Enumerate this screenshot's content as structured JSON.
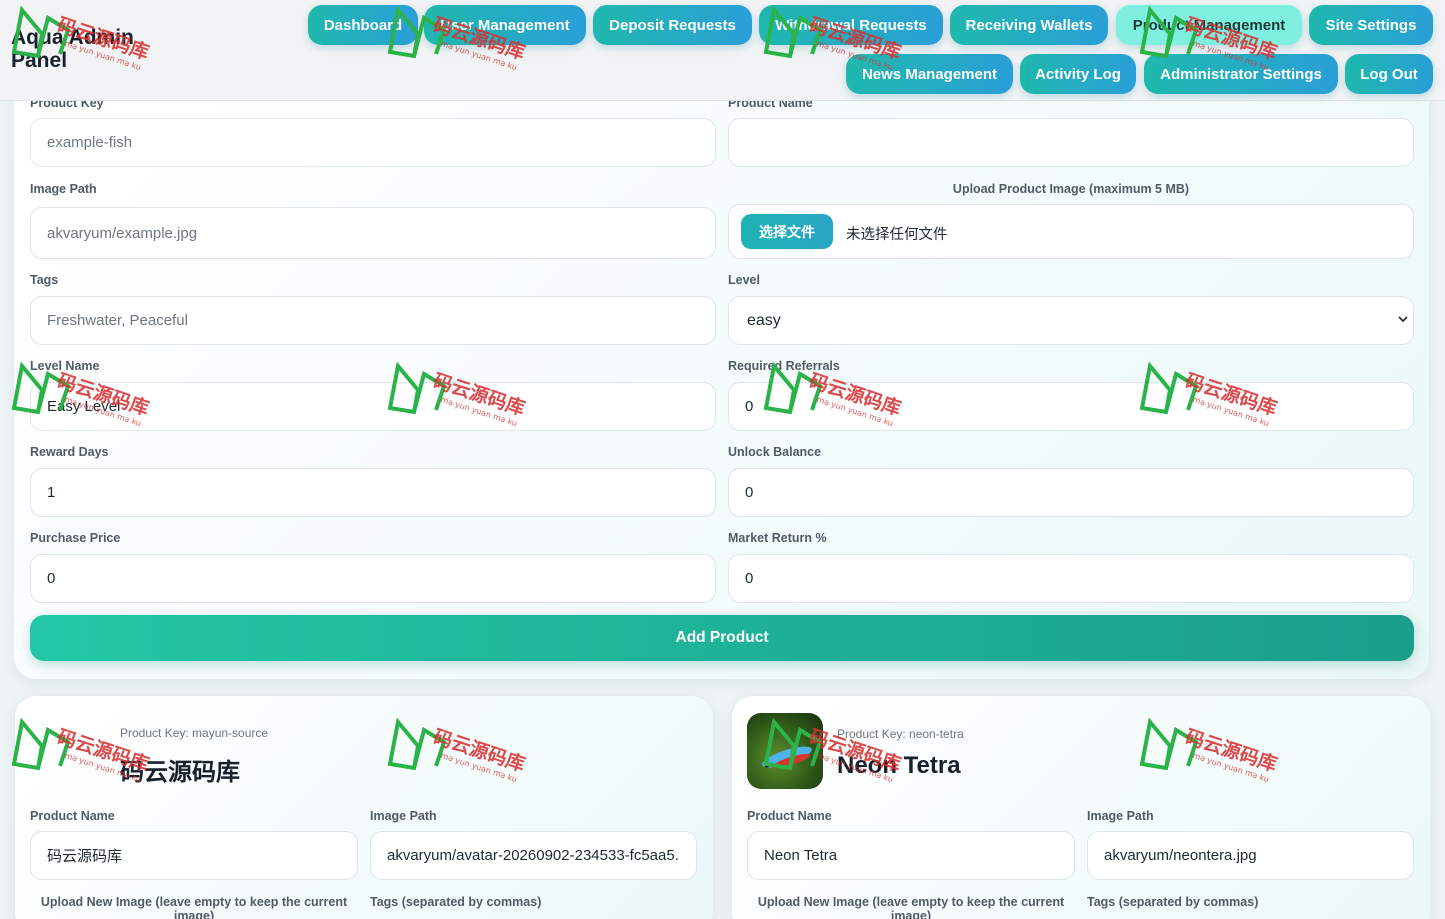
{
  "header": {
    "brand": "Aqua Admin Panel",
    "nav": [
      {
        "label": "Dashboard"
      },
      {
        "label": "User Management"
      },
      {
        "label": "Deposit Requests"
      },
      {
        "label": "Withdrawal Requests"
      },
      {
        "label": "Receiving Wallets"
      },
      {
        "label": "Product Management",
        "active": true
      },
      {
        "label": "Site Settings"
      },
      {
        "label": "News Management"
      },
      {
        "label": "Activity Log"
      },
      {
        "label": "Administrator Settings"
      },
      {
        "label": "Log Out"
      }
    ]
  },
  "form": {
    "product_key": {
      "label": "Product Key",
      "placeholder": "example-fish"
    },
    "product_name": {
      "label": "Product Name",
      "value": ""
    },
    "image_path": {
      "label": "Image Path",
      "placeholder": "akvaryum/example.jpg"
    },
    "upload": {
      "label": "Upload Product Image (maximum 5 MB)",
      "button": "选择文件",
      "status": "未选择任何文件"
    },
    "tags": {
      "label": "Tags",
      "placeholder": "Freshwater, Peaceful"
    },
    "level": {
      "label": "Level",
      "value": "easy"
    },
    "level_name": {
      "label": "Level Name",
      "value": "Easy Level"
    },
    "required_referrals": {
      "label": "Required Referrals",
      "value": "0"
    },
    "reward_days": {
      "label": "Reward Days",
      "value": "1"
    },
    "unlock_balance": {
      "label": "Unlock Balance",
      "value": "0"
    },
    "purchase_price": {
      "label": "Purchase Price",
      "value": "0"
    },
    "market_return": {
      "label": "Market Return %",
      "value": "0"
    },
    "submit": "Add Product"
  },
  "products": [
    {
      "key_label": "Product Key: mayun-source",
      "title": "码云源码库",
      "name_label": "Product Name",
      "name_value": "码云源码库",
      "path_label": "Image Path",
      "path_value": "akvaryum/avatar-20260902-234533-fc5aa5.",
      "upload_label": "Upload New Image (leave empty to keep the current image)",
      "tags_label": "Tags (separated by commas)"
    },
    {
      "key_label": "Product Key: neon-tetra",
      "title": "Neon Tetra",
      "name_label": "Product Name",
      "name_value": "Neon Tetra",
      "path_label": "Image Path",
      "path_value": "akvaryum/neontera.jpg",
      "upload_label": "Upload New Image (leave empty to keep the current image)",
      "tags_label": "Tags (separated by commas)"
    }
  ],
  "watermark": {
    "text": "码云源码库",
    "sub": "ma yun yuan ma ku",
    "color": "#d63232"
  }
}
